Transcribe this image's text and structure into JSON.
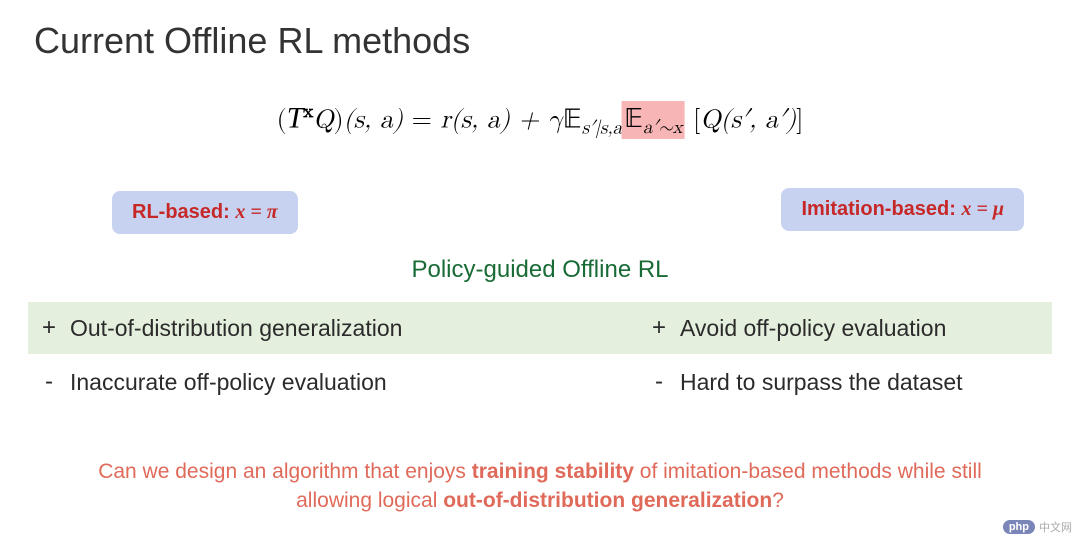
{
  "title": "Current Offline RL methods",
  "equation": {
    "lhs_open": "(",
    "T": "T",
    "sup_x": "x",
    "Q": "Q",
    "lhs_close": ")",
    "args1": "(s, a)",
    "eq": " = ",
    "r": "r(s, a) + ",
    "gamma": "γ",
    "E1": "𝔼",
    "E1_sub": "s′|s,a",
    "E2": "𝔼",
    "E2_sub": "a′∼x",
    "tail_open": " [",
    "Q2": "Q",
    "args2": "(s′, a′)",
    "tail_close": "]"
  },
  "badges": {
    "left_prefix": "RL-based: ",
    "left_eq": "x = π",
    "right_prefix": "Imitation-based: ",
    "right_eq": "x = μ"
  },
  "subtitle": "Policy-guided Offline RL",
  "rows": {
    "plus_left": "Out-of-distribution generalization",
    "plus_right": "Avoid off-policy evaluation",
    "minus_left": "Inaccurate off-policy evaluation",
    "minus_right": "Hard to surpass the dataset",
    "plus_sign": "+",
    "minus_sign": "-"
  },
  "question": {
    "p1": "Can we design an algorithm that enjoys ",
    "b1": "training stability",
    "p2": " of imitation-based methods while still allowing logical ",
    "b2": "out-of-distribution generalization",
    "p3": "?"
  },
  "watermark": {
    "pill": "php",
    "text": "中文网"
  }
}
